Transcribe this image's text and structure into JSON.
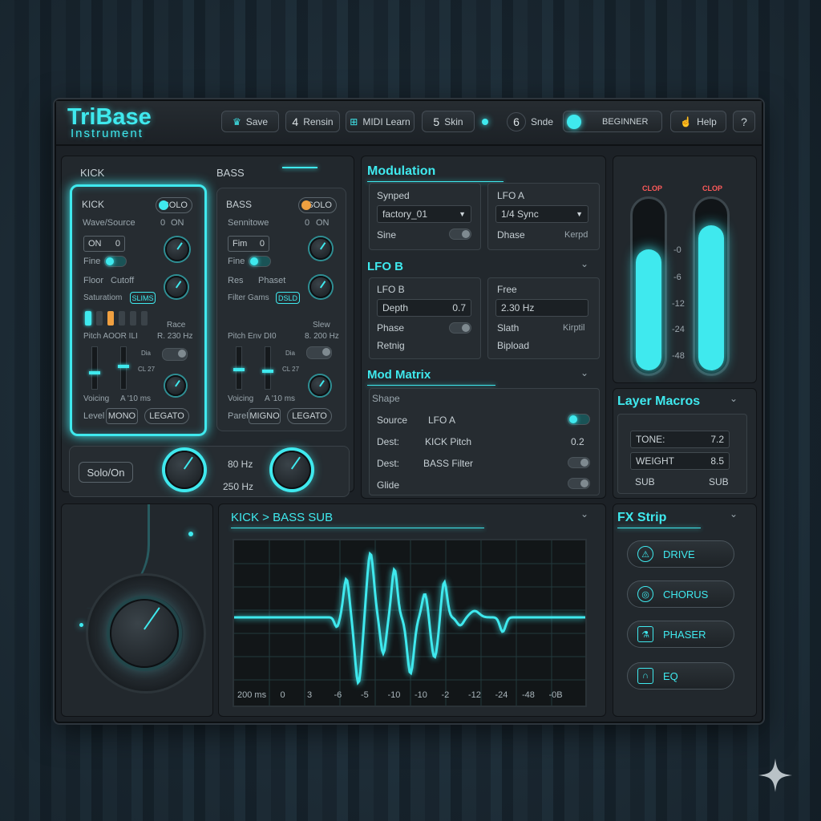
{
  "app": {
    "title": "TriBase",
    "subtitle": "Instrument"
  },
  "toolbar": {
    "save": "Save",
    "rename_num": "4",
    "rename": "Rensin",
    "midi": "MIDI Learn",
    "skin_num": "5",
    "skin": "Skin",
    "side_num": "6",
    "side": "Snde",
    "mode": "BEGINNER",
    "help": "Help",
    "question": "?"
  },
  "tabs": {
    "kick": "KICK",
    "bass": "BASS"
  },
  "kick": {
    "title": "KICK",
    "solo": "SOLO",
    "wave": "Wave/Source",
    "wave_val": "0",
    "wave_on": "ON",
    "on": "ON",
    "on_val": "0",
    "fine": "Fine",
    "floor": "Floor",
    "cutoff": "Cutoff",
    "saturation": "Saturatiom",
    "sat_btn": "SLIMS",
    "pitch": "Pitch AOOR ILI",
    "rate": "Race",
    "rate_val": "R. 230 Hz",
    "small1": "Dia",
    "small2": "CL 27",
    "voicing": "Voicing",
    "voicing_val": "A '10 ms",
    "level": "Level",
    "mono": "MONO",
    "legato": "LEGATO"
  },
  "bass": {
    "title": "BASS",
    "solo": "SOLO",
    "sens": "Sennitowe",
    "sens_val": "0",
    "sens_on": "ON",
    "film": "Fim",
    "film_val": "0",
    "fine": "Fine",
    "res": "Res",
    "phase": "Phaset",
    "filter": "Filter Gams",
    "filter_btn": "DSLD",
    "pitch": "Pitch Env DI0",
    "slew": "Slew",
    "slew_val": "8. 200 Hz",
    "small1": "Dia",
    "small2": "CL 27",
    "voicing": "Voicing",
    "voicing_val": "A '10 ms",
    "panel": "Parel",
    "mono": "MIGNO",
    "legato": "LEGATO"
  },
  "crossover": {
    "solo": "Solo/On",
    "freq1": "80 Hz",
    "freq2": "250 Hz"
  },
  "modulation": {
    "title": "Modulation",
    "synped": "Synped",
    "preset": "factory_01",
    "sine": "Sine",
    "lfoa": "LFO A",
    "sync": "1/4 Sync",
    "dhase": "Dhase",
    "kerpd": "Kerpd"
  },
  "lfob": {
    "title": "LFO B",
    "sub": "LFO B",
    "depth": "Depth",
    "depth_val": "0.7",
    "phase": "Phase",
    "retrig": "Retnig",
    "free": "Free",
    "hz": "2.30 Hz",
    "slath": "Slath",
    "kirptl": "Kirptil",
    "bipload": "Bipload"
  },
  "modmatrix": {
    "title": "Mod Matrix",
    "shape": "Shape",
    "rows": [
      {
        "k": "Source",
        "v": "LFO A",
        "val": ""
      },
      {
        "k": "Dest:",
        "v": "KICK Pitch",
        "val": "0.2"
      },
      {
        "k": "Dest:",
        "v": "BASS Filter",
        "val": ""
      },
      {
        "k": "Glide",
        "v": "",
        "val": ""
      }
    ]
  },
  "meters": {
    "clip1": "CLOP",
    "clip2": "CLOP",
    "ticks": [
      "-0",
      "-6",
      "-12",
      "-24",
      "-48"
    ],
    "levels": [
      0.72,
      0.86
    ]
  },
  "macros": {
    "title": "Layer Macros",
    "rows": [
      {
        "k": "TONE:",
        "v": "7.2"
      },
      {
        "k": "WEIGHT",
        "v": "8.5"
      },
      {
        "k": "SUB",
        "v": "SUB"
      }
    ]
  },
  "scope": {
    "title": "KICK > BASS SUB",
    "axis": [
      "200 ms",
      "0",
      "3",
      "-6",
      "-5",
      "-10",
      "-10",
      "-2",
      "-12",
      "-24",
      "-48",
      "-0B"
    ]
  },
  "fx": {
    "title": "FX Strip",
    "items": [
      {
        "label": "DRIVE",
        "icon": "drive-icon"
      },
      {
        "label": "CHORUS",
        "icon": "chorus-icon"
      },
      {
        "label": "PHASER",
        "icon": "flask-icon"
      },
      {
        "label": "EQ",
        "icon": "eq-icon"
      }
    ]
  },
  "colors": {
    "accent": "#3fe9ee",
    "orange": "#f0a040",
    "bg": "#1c2126"
  }
}
